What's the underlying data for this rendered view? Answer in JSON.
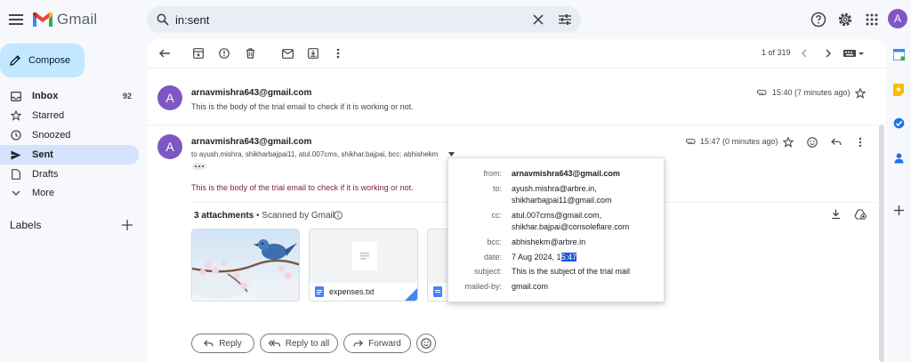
{
  "app": {
    "name": "Gmail"
  },
  "search": {
    "value": "in:sent"
  },
  "avatar_letter": "A",
  "sidebar": {
    "compose": "Compose",
    "items": [
      {
        "label": "Inbox",
        "count": "92"
      },
      {
        "label": "Starred",
        "count": ""
      },
      {
        "label": "Snoozed",
        "count": ""
      },
      {
        "label": "Sent",
        "count": ""
      },
      {
        "label": "Drafts",
        "count": ""
      },
      {
        "label": "More",
        "count": ""
      }
    ],
    "labels_title": "Labels"
  },
  "toolbar": {
    "page_count": "1 of 319"
  },
  "messages": [
    {
      "sender": "arnavmishra643@gmail.com",
      "body": "This is the body of the trial email to check if it is working or not.",
      "time": "15:40 (7 minutes ago)"
    },
    {
      "sender": "arnavmishra643@gmail.com",
      "recipients": "to ayush.mishra, shikharbajpai11, atul.007cms, shikhar.bajpai, bcc: abhishekm",
      "body": "This is the body of the trial email to check if it is working or not.",
      "time": "15:47 (0 minutes ago)"
    }
  ],
  "attachments": {
    "title": "3 attachments",
    "scanned": "• Scanned by Gmail",
    "files": [
      "expenses.txt"
    ]
  },
  "actions": {
    "reply": "Reply",
    "reply_all": "Reply to all",
    "forward": "Forward"
  },
  "details": {
    "from_label": "from:",
    "from": "arnavmishra643@gmail.com",
    "to_label": "to:",
    "to_1": "ayush.mishra@arbre.in,",
    "to_2": "shikharbajpai11@gmail.com",
    "cc_label": "cc:",
    "cc_1": "atul.007cms@gmail.com,",
    "cc_2": "shikhar.bajpai@consoleflare.com",
    "bcc_label": "bcc:",
    "bcc": "abhishekm@arbre.in",
    "date_label": "date:",
    "date_prefix": "7 Aug 2024, 1",
    "date_selected": "5:47",
    "subject_label": "subject:",
    "subject": "This is the subject of the trial mail",
    "mailed_label": "mailed-by:",
    "mailed_by": "gmail.com"
  },
  "colors": {
    "accent": "#0b57d0",
    "avatar": "#7e57c2",
    "compose": "#c2e7ff",
    "active_nav": "#d3e3fd"
  }
}
